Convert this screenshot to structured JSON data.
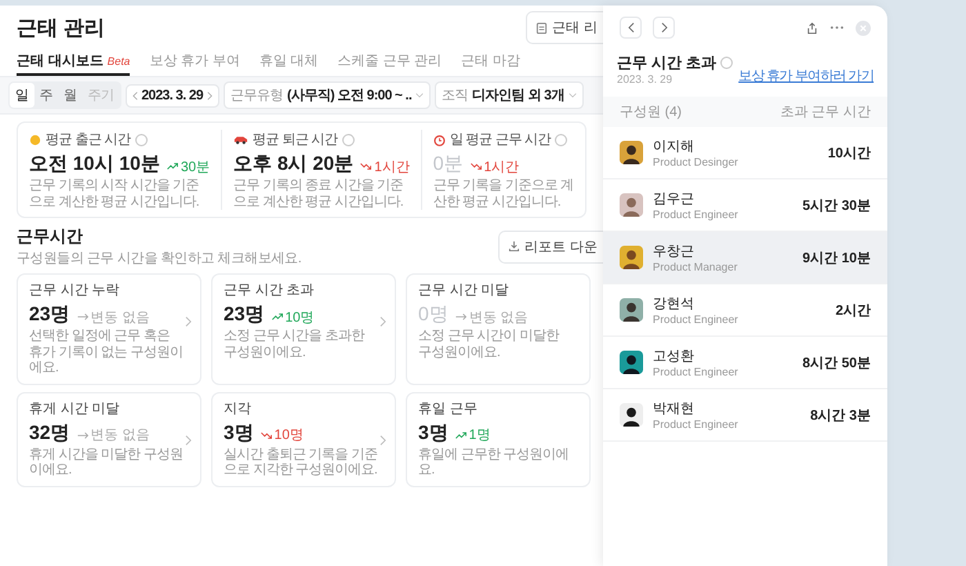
{
  "header": {
    "title": "근태 관리",
    "action_button": "근태 리"
  },
  "tabs": [
    {
      "label": "근태 대시보드",
      "badge": "Beta",
      "selected": true
    },
    {
      "label": "보상 휴가 부여",
      "selected": false
    },
    {
      "label": "휴일 대체",
      "selected": false
    },
    {
      "label": "스케줄 근무 관리",
      "selected": false
    },
    {
      "label": "근태 마감",
      "selected": false
    }
  ],
  "filters": {
    "periods": [
      {
        "label": "일",
        "selected": true,
        "disabled": false
      },
      {
        "label": "주",
        "selected": false,
        "disabled": false
      },
      {
        "label": "월",
        "selected": false,
        "disabled": false
      },
      {
        "label": "주기",
        "selected": false,
        "disabled": true
      }
    ],
    "date": "2023. 3. 29",
    "work_type": {
      "label": "근무유형",
      "value": "(사무직) 오전 9:00 ~ .."
    },
    "organization": {
      "label": "조직",
      "value": "디자인팀 외 3개"
    }
  },
  "stats": [
    {
      "label": "평균 출근 시간",
      "value": "오전 10시 10분",
      "muted": false,
      "kind": "up",
      "change": "30분",
      "description": "근무 기록의 시작 시간을 기준으로 계산한 평균 시간입니다."
    },
    {
      "label": "평균 퇴근 시간",
      "value": "오후 8시 20분",
      "muted": false,
      "kind": "down",
      "change": "1시간",
      "description": "근무 기록의 종료 시간을 기준으로 계산한 평균 시간입니다."
    },
    {
      "label": "일 평균 근무 시간",
      "value": "0분",
      "muted": true,
      "kind": "down",
      "change": "1시간",
      "description": "근무 기록을 기준으로 계산한 평균 시간입니다."
    }
  ],
  "section": {
    "title": "근무시간",
    "subtitle": "구성원들의 근무 시간을 확인하고 체크해보세요.",
    "download_button": "리포트 다운"
  },
  "cards": [
    {
      "title": "근무 시간 누락",
      "value": "23명",
      "muted": false,
      "kind": "flat",
      "change": "변동 없음",
      "description": "선택한 일정에 근무 혹은 휴가 기록이 없는 구성원이에요."
    },
    {
      "title": "근무 시간 초과",
      "value": "23명",
      "muted": false,
      "kind": "up",
      "change": "10명",
      "description": "소정 근무 시간을 초과한 구성원이에요."
    },
    {
      "title": "근무 시간 미달",
      "value": "0명",
      "muted": true,
      "kind": "flat",
      "change": "변동 없음",
      "description": "소정 근무 시간이 미달한 구성원이에요."
    },
    {
      "title": "휴게 시간 미달",
      "value": "32명",
      "muted": false,
      "kind": "flat",
      "change": "변동 없음",
      "description": "휴게 시간을 미달한 구성원이에요."
    },
    {
      "title": "지각",
      "value": "3명",
      "muted": false,
      "kind": "down",
      "change": "10명",
      "description": "실시간 출퇴근 기록을 기준으로 지각한 구성원이에요."
    },
    {
      "title": "휴일 근무",
      "value": "3명",
      "muted": false,
      "kind": "up",
      "change": "1명",
      "description": "휴일에 근무한 구성원이에요."
    }
  ],
  "panel": {
    "title": "근무 시간 초과",
    "date": "2023. 3. 29",
    "link": "보상 휴가 부여하러 가기",
    "column_member": "구성원 (4)",
    "column_overtime": "초과 근무 시간",
    "members": [
      {
        "name": "이지해",
        "role": "Product Desinger",
        "overtime": "10시간",
        "selected": false
      },
      {
        "name": "김우근",
        "role": "Product Engineer",
        "overtime": "5시간 30분",
        "selected": false
      },
      {
        "name": "우창근",
        "role": "Product Manager",
        "overtime": "9시간 10분",
        "selected": true
      },
      {
        "name": "강현석",
        "role": "Product Engineer",
        "overtime": "2시간",
        "selected": false
      },
      {
        "name": "고성환",
        "role": "Product Engineer",
        "overtime": "8시간 50분",
        "selected": false
      },
      {
        "name": "박재현",
        "role": "Product Engineer",
        "overtime": "8시간 3분",
        "selected": false
      }
    ]
  }
}
